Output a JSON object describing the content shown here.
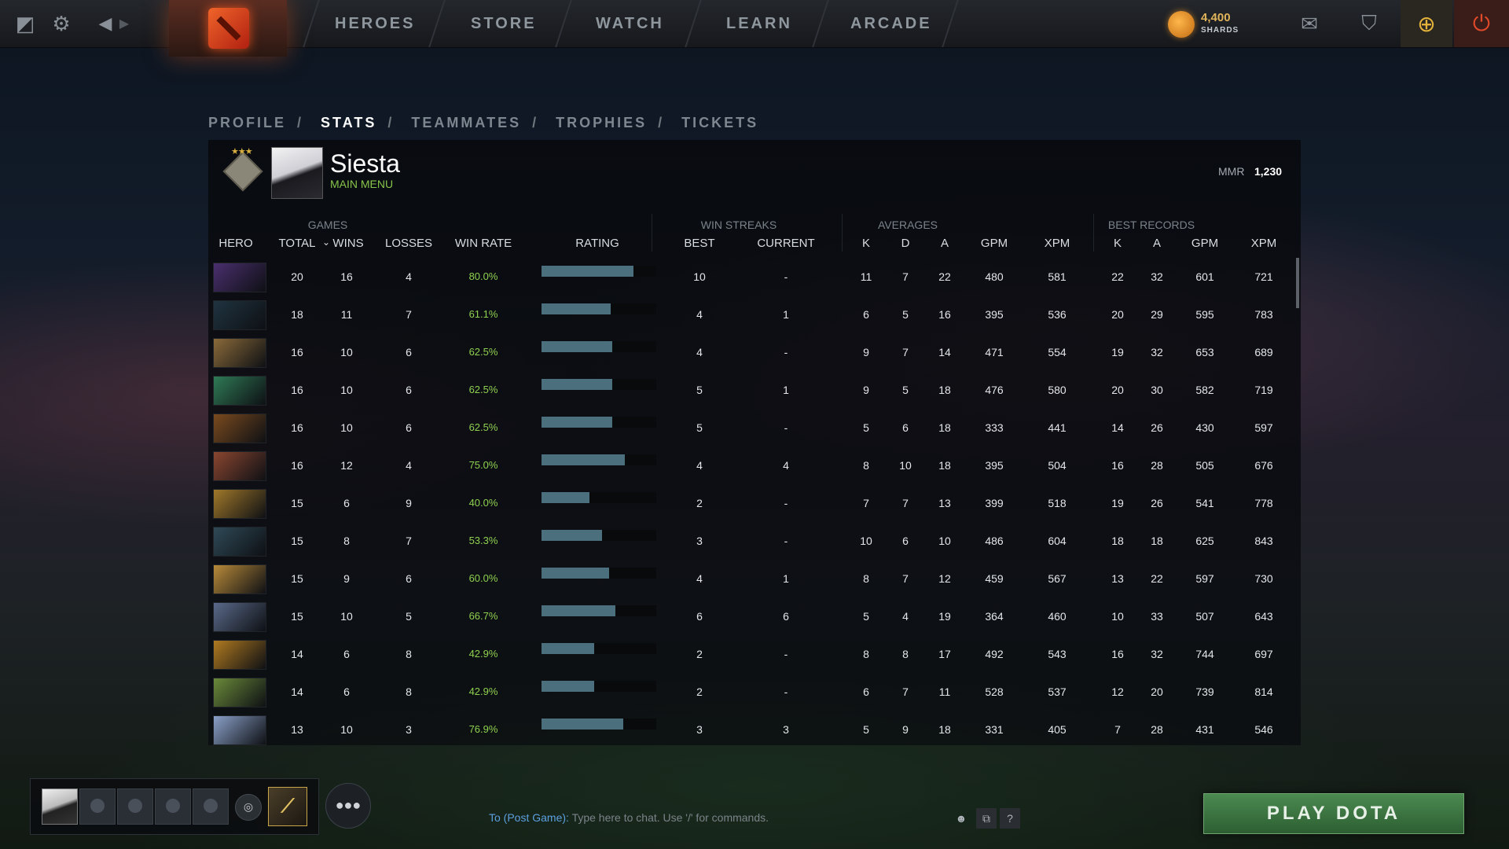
{
  "topnav": {
    "items": [
      "HEROES",
      "STORE",
      "WATCH",
      "LEARN",
      "ARCADE"
    ],
    "shards_value": "4,400",
    "shards_label": "SHARDS",
    "icons": [
      "dota-logo-icon",
      "gear-icon",
      "back-arrow-icon",
      "forward-arrow-icon",
      "mail-icon",
      "armory-icon",
      "plus-icon",
      "power-icon"
    ]
  },
  "breadcrumb": {
    "items": [
      "PROFILE",
      "STATS",
      "TEAMMATES",
      "TROPHIES",
      "TICKETS"
    ],
    "separator": "/",
    "active_index": 1
  },
  "profile": {
    "name": "Siesta",
    "status": "MAIN MENU",
    "mmr_label": "MMR",
    "mmr_value": "1,230"
  },
  "table": {
    "groups": {
      "games": "GAMES",
      "win_streaks": "WIN STREAKS",
      "averages": "AVERAGES",
      "best_records": "BEST RECORDS"
    },
    "columns": {
      "hero": "HERO",
      "total": "TOTAL",
      "wins": "WINS",
      "losses": "LOSSES",
      "win_rate": "WIN RATE",
      "rating": "RATING",
      "best": "BEST",
      "current": "CURRENT",
      "k": "K",
      "d": "D",
      "a": "A",
      "gpm": "GPM",
      "xpm": "XPM",
      "bk": "K",
      "ba": "A",
      "bgpm": "GPM",
      "bxpm": "XPM"
    },
    "sort_indicator": "⌄",
    "rows": [
      {
        "total": "20",
        "wins": "16",
        "losses": "4",
        "win_rate": "80.0%",
        "rating": 0.65,
        "best": "10",
        "current": "-",
        "k": "11",
        "d": "7",
        "a": "22",
        "gpm": "480",
        "xpm": "581",
        "bk": "22",
        "ba": "32",
        "bgpm": "601",
        "bxpm": "721",
        "hero_color": "#4a2f6e"
      },
      {
        "total": "18",
        "wins": "11",
        "losses": "7",
        "win_rate": "61.1%",
        "rating": 0.49,
        "best": "4",
        "current": "1",
        "k": "6",
        "d": "5",
        "a": "16",
        "gpm": "395",
        "xpm": "536",
        "bk": "20",
        "ba": "29",
        "bgpm": "595",
        "bxpm": "783",
        "hero_color": "#1f3440"
      },
      {
        "total": "16",
        "wins": "10",
        "losses": "6",
        "win_rate": "62.5%",
        "rating": 0.5,
        "best": "4",
        "current": "-",
        "k": "9",
        "d": "7",
        "a": "14",
        "gpm": "471",
        "xpm": "554",
        "bk": "19",
        "ba": "32",
        "bgpm": "653",
        "bxpm": "689",
        "hero_color": "#8a6a3a"
      },
      {
        "total": "16",
        "wins": "10",
        "losses": "6",
        "win_rate": "62.5%",
        "rating": 0.5,
        "best": "5",
        "current": "1",
        "k": "9",
        "d": "5",
        "a": "18",
        "gpm": "476",
        "xpm": "580",
        "bk": "20",
        "ba": "30",
        "bgpm": "582",
        "bxpm": "719",
        "hero_color": "#2f7a55"
      },
      {
        "total": "16",
        "wins": "10",
        "losses": "6",
        "win_rate": "62.5%",
        "rating": 0.5,
        "best": "5",
        "current": "-",
        "k": "5",
        "d": "6",
        "a": "18",
        "gpm": "333",
        "xpm": "441",
        "bk": "14",
        "ba": "26",
        "bgpm": "430",
        "bxpm": "597",
        "hero_color": "#7a4a1e"
      },
      {
        "total": "16",
        "wins": "12",
        "losses": "4",
        "win_rate": "75.0%",
        "rating": 0.59,
        "best": "4",
        "current": "4",
        "k": "8",
        "d": "10",
        "a": "18",
        "gpm": "395",
        "xpm": "504",
        "bk": "16",
        "ba": "28",
        "bgpm": "505",
        "bxpm": "676",
        "hero_color": "#8a4630"
      },
      {
        "total": "15",
        "wins": "6",
        "losses": "9",
        "win_rate": "40.0%",
        "rating": 0.34,
        "best": "2",
        "current": "-",
        "k": "7",
        "d": "7",
        "a": "13",
        "gpm": "399",
        "xpm": "518",
        "bk": "19",
        "ba": "26",
        "bgpm": "541",
        "bxpm": "778",
        "hero_color": "#a0782a"
      },
      {
        "total": "15",
        "wins": "8",
        "losses": "7",
        "win_rate": "53.3%",
        "rating": 0.43,
        "best": "3",
        "current": "-",
        "k": "10",
        "d": "6",
        "a": "10",
        "gpm": "486",
        "xpm": "604",
        "bk": "18",
        "ba": "18",
        "bgpm": "625",
        "bxpm": "843",
        "hero_color": "#2e4a56"
      },
      {
        "total": "15",
        "wins": "9",
        "losses": "6",
        "win_rate": "60.0%",
        "rating": 0.48,
        "best": "4",
        "current": "1",
        "k": "8",
        "d": "7",
        "a": "12",
        "gpm": "459",
        "xpm": "567",
        "bk": "13",
        "ba": "22",
        "bgpm": "597",
        "bxpm": "730",
        "hero_color": "#b88a3a"
      },
      {
        "total": "15",
        "wins": "10",
        "losses": "5",
        "win_rate": "66.7%",
        "rating": 0.52,
        "best": "6",
        "current": "6",
        "k": "5",
        "d": "4",
        "a": "19",
        "gpm": "364",
        "xpm": "460",
        "bk": "10",
        "ba": "33",
        "bgpm": "507",
        "bxpm": "643",
        "hero_color": "#5a6a8a"
      },
      {
        "total": "14",
        "wins": "6",
        "losses": "8",
        "win_rate": "42.9%",
        "rating": 0.37,
        "best": "2",
        "current": "-",
        "k": "8",
        "d": "8",
        "a": "17",
        "gpm": "492",
        "xpm": "543",
        "bk": "16",
        "ba": "32",
        "bgpm": "744",
        "bxpm": "697",
        "hero_color": "#b07a20"
      },
      {
        "total": "14",
        "wins": "6",
        "losses": "8",
        "win_rate": "42.9%",
        "rating": 0.37,
        "best": "2",
        "current": "-",
        "k": "6",
        "d": "7",
        "a": "11",
        "gpm": "528",
        "xpm": "537",
        "bk": "12",
        "ba": "20",
        "bgpm": "739",
        "bxpm": "814",
        "hero_color": "#6a8a3a"
      },
      {
        "total": "13",
        "wins": "10",
        "losses": "3",
        "win_rate": "76.9%",
        "rating": 0.58,
        "best": "3",
        "current": "3",
        "k": "5",
        "d": "9",
        "a": "18",
        "gpm": "331",
        "xpm": "405",
        "bk": "7",
        "ba": "28",
        "bgpm": "431",
        "bxpm": "546",
        "hero_color": "#8aa0c8"
      }
    ]
  },
  "bottom": {
    "chat_to": "To (Post Game):",
    "chat_hint": "Type here to chat. Use '/' for commands.",
    "play_label": "PLAY DOTA",
    "help_label": "?"
  }
}
